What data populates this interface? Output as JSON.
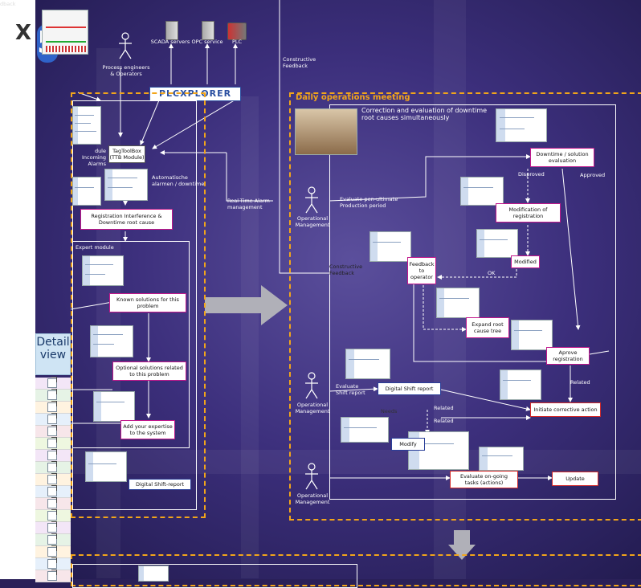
{
  "left_panel": {
    "close_label": "X",
    "detail_label": "Detail view"
  },
  "top": {
    "feedback_partial": "dback",
    "process_engineers": "Process engineers\n& Operators",
    "scada": "SCADA servers",
    "opc": "OPC service",
    "plc": "PLC",
    "constructive_feedback": "Constructive\nFeedback",
    "logo": "PLCXPLORER"
  },
  "left_section": {
    "incoming": "dule Incoming\nAlarms",
    "tagtoolbox": "TagToolBox\n(TTB Module)",
    "auto_alarms": "Automatische\nalarmen / downtime",
    "registration": "Registration Interference &\nDowntime root cause",
    "expert_module": "Expert module",
    "known": "Known solutions for this\nproblem",
    "optional": "Optional solutions related\nto this problem",
    "add_expertise": "Add your expertise\nto the system",
    "digital_shift": "Digital Shift-report",
    "realtime": "Real-Time Alarm\nmanagement"
  },
  "meeting": {
    "title": "Daily operations meeting",
    "correction": "Correction and evaluation of downtime\nroot causes simultaneously",
    "evaluate_pen": "Evaluate pen-ultimate\nProduction period",
    "op_mgmt": "Operational\nManagement",
    "downtime_eval": "Downtime / solution\nevaluation",
    "disproved": "Disproved",
    "approved": "Approved",
    "modification": "Modification of\nregistration",
    "modified": "Modified",
    "feedback_op": "Feedback\nto\noperator",
    "ok": "OK",
    "constructive": "Constructive\nFeedback",
    "expand": "Expand root\ncause tree",
    "aprove": "Aprove\nregistration",
    "evaluate_shift": "Evaluate\nShift report",
    "digital_shift_report": "Digital Shift report",
    "related": "Related",
    "needs": "Needs",
    "initiate": "Initiate corrective action",
    "modify": "Modify",
    "evaluate_ongoing": "Evaluate on-going\ntasks (actions)",
    "update": "Update"
  },
  "colors": {
    "accent_dash": "#f2a51a",
    "magenta": "#c2188c",
    "blue": "#2a3f99",
    "red": "#d32a2a"
  }
}
